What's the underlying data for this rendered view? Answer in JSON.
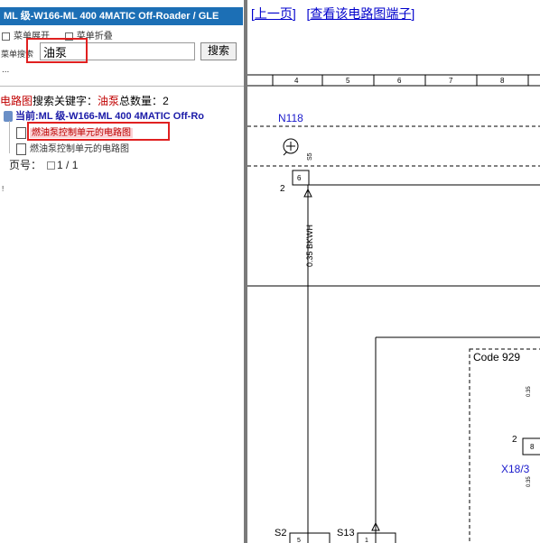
{
  "left": {
    "title": "ML 级-W166-ML 400 4MATIC Off-Roader / GLE",
    "menu_expand": "菜单展开",
    "menu_collapse": "菜单折叠",
    "search_label": "菜单搜索",
    "search_value": "油泵",
    "search_button": "搜索",
    "ellipsis": "...",
    "result": {
      "type_label": "电路图",
      "keyword_label": "搜索关键字：",
      "keyword": "油泵",
      "count_label": "总数量：",
      "count": "2"
    },
    "current": "当前:ML 级-W166-ML 400 4MATIC Off-Ro",
    "items": [
      "燃油泵控制单元的电路图",
      "燃油泵控制单元的电路图"
    ],
    "pager_label": "页号：",
    "pager_value": "1 / 1",
    "tiny_mark": "!"
  },
  "right": {
    "nav_prev": "上一页",
    "nav_connector": "查看该电路图端子",
    "ruler": [
      "4",
      "5",
      "6",
      "7",
      "8"
    ],
    "labels": {
      "n118": "N118",
      "wire_top": "6",
      "pin2": "2",
      "wire_color": "0.35 BKWH",
      "code": "Code 929",
      "x18_pin": "2",
      "x18_num": "8",
      "x18": "X18/3",
      "s2": "S2",
      "s2_pin": "5",
      "s13": "S13",
      "s13_pin": "1",
      "small_text": "0.35"
    }
  },
  "colors": {
    "title_bg": "#1c6fb5",
    "link": "#0000cc",
    "highlight": "#e02020",
    "schematic_blue": "#1a1acc"
  }
}
